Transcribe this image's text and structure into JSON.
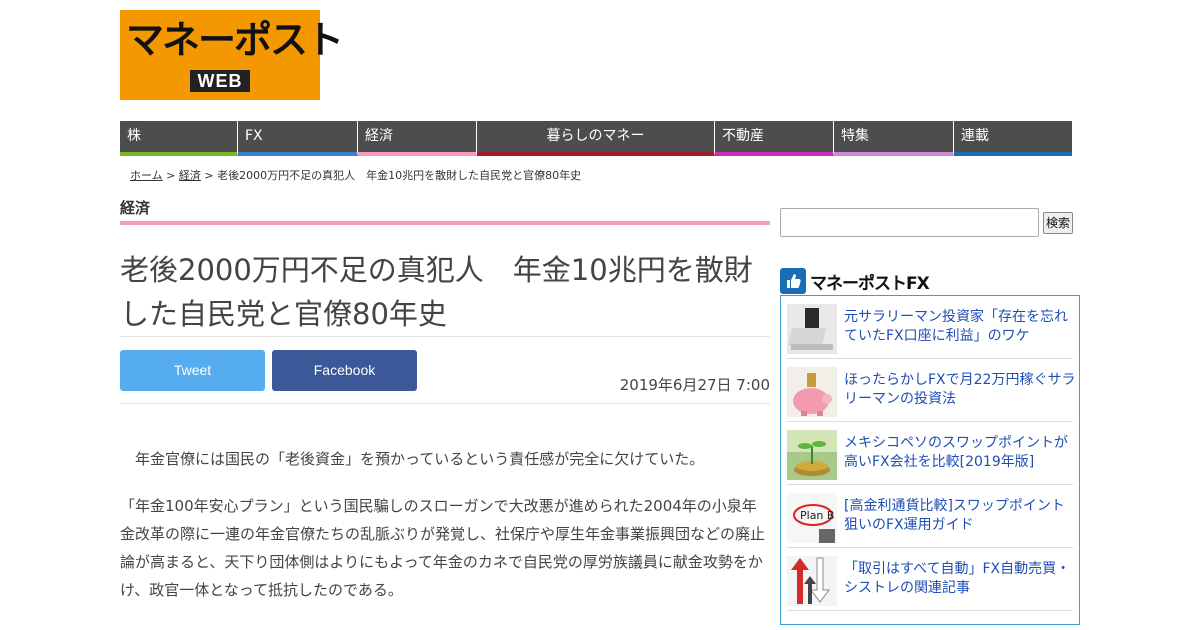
{
  "logo": {
    "main": "マネーポスト",
    "sub": "WEB"
  },
  "nav": [
    {
      "label": "株",
      "color": "#7bb52a",
      "width": 118
    },
    {
      "label": "FX",
      "color": "#3c7fd0",
      "width": 120
    },
    {
      "label": "経済",
      "color": "#f29cc3",
      "width": 119
    },
    {
      "label": "暮らしのマネー",
      "color": "#a5172c",
      "width": 238
    },
    {
      "label": "不動産",
      "color": "#c92fb3",
      "width": 119
    },
    {
      "label": "特集",
      "color": "#c88ad0",
      "width": 120
    },
    {
      "label": "連載",
      "color": "#1a6db5",
      "width": 118
    }
  ],
  "breadcrumb": {
    "home": "ホーム",
    "sep": " > ",
    "category": "経済",
    "current": "老後2000万円不足の真犯人　年金10兆円を散財した自民党と官僚80年史"
  },
  "article": {
    "category": "経済",
    "title": "老後2000万円不足の真犯人　年金10兆円を散財した自民党と官僚80年史",
    "tweet_label": "Tweet",
    "facebook_label": "Facebook",
    "date": "2019年6月27日 7:00",
    "paragraphs": [
      "年金官僚には国民の「老後資金」を預かっているという責任感が完全に欠けていた。",
      "「年金100年安心プラン」という国民騙しのスローガンで大改悪が進められた2004年の小泉年金改革の際に一連の年金官僚たちの乱脈ぶりが発覚し、社保庁や厚生年金事業振興団などの廃止論が高まると、天下り団体側はよりにもよって年金のカネで自民党の厚労族議員に献金攻勢をかけ、政官一体となって抵抗したのである。"
    ]
  },
  "search": {
    "placeholder": "",
    "button": "検索"
  },
  "fx_widget": {
    "title": "マネーポストFX",
    "items": [
      {
        "text": "元サラリーマン投資家「存在を忘れていたFX口座に利益」のワケ",
        "thumb": "laptop-photo"
      },
      {
        "text": "ほったらかしFXで月22万円稼ぐサラリーマンの投資法",
        "thumb": "piggy-bank-photo"
      },
      {
        "text": "メキシコペソのスワップポイントが高いFX会社を比較[2019年版]",
        "thumb": "plant-coins-photo"
      },
      {
        "text": "[高金利通貨比較]スワップポイント狙いのFX運用ガイド",
        "thumb": "plan-b-photo",
        "thumb_label": "Plan B"
      },
      {
        "text": "「取引はすべて自動」FX自動売買・シストレの関連記事",
        "thumb": "arrows-photo"
      }
    ]
  },
  "colors": {
    "logo_bg": "#f39800",
    "link": "#1f4eb4",
    "category_line": "#f29cc3",
    "tweet": "#55acee",
    "facebook": "#3b5998",
    "fx_border": "#3f9fd2"
  }
}
